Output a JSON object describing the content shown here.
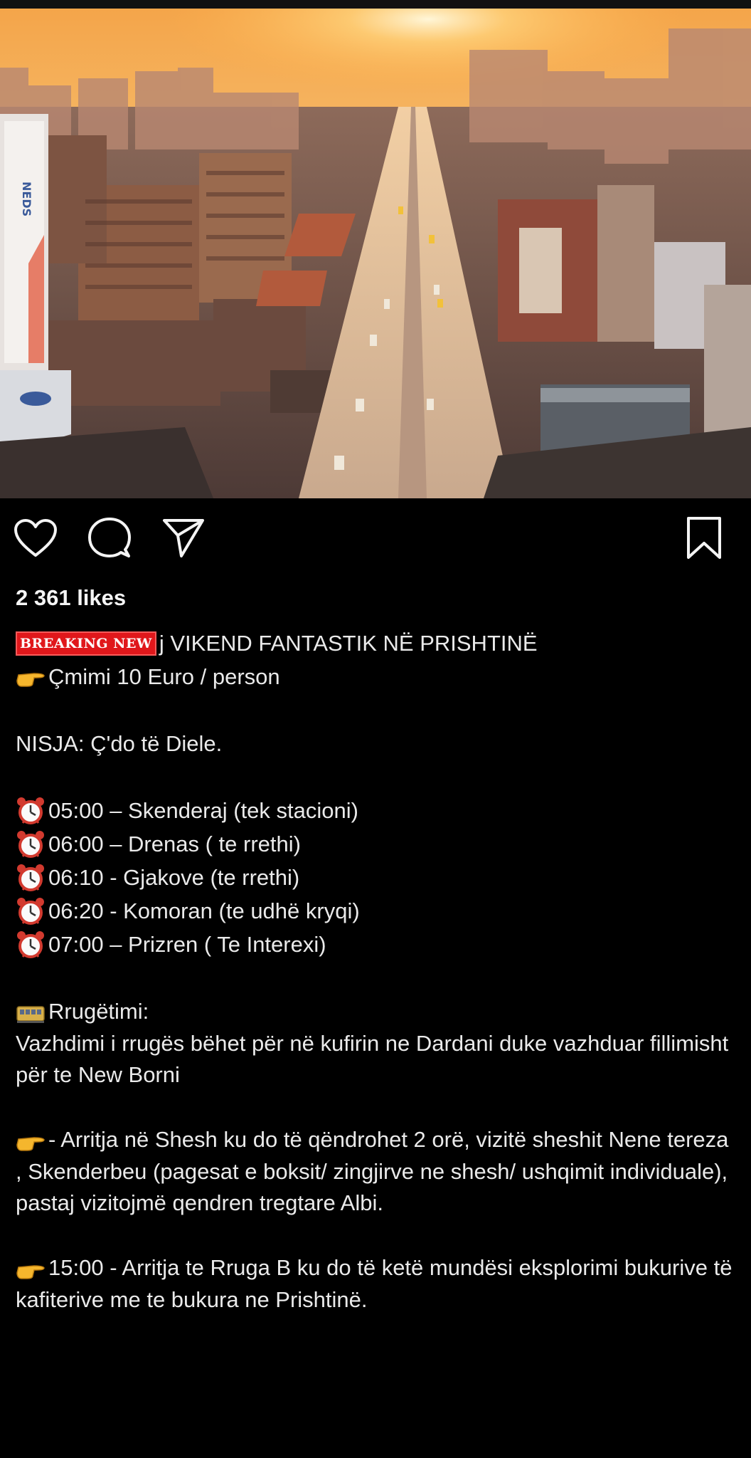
{
  "post": {
    "likes": "2 361 likes",
    "breaking_badge": "BREAKING NEW",
    "title_rest": "j VIKEND FANTASTIK NË PRISHTINË",
    "price": "Çmimi 10 Euro / person",
    "departure": "NISJA:  Ç'do të Diele.",
    "schedule": [
      {
        "text": "05:00 – Skenderaj (tek stacioni)"
      },
      {
        "text": "06:00 –  Drenas ( te rrethi)"
      },
      {
        "text": "06:10 -  Gjakove (te rrethi)"
      },
      {
        "text": "06:20 -  Komoran (te udhë kryqi)"
      },
      {
        "text": "07:00 – Prizren ( Te Interexi)"
      }
    ],
    "route_heading": "Rrugëtimi:",
    "route_text": "Vazhdimi i rrugës bëhet për në kufirin ne Dardani duke vazhduar fillimisht për te New Borni",
    "arrival_text": "- Arritja në Shesh ku do të qëndrohet 2 orë, vizitë sheshit Nene tereza , Skenderbeu (pagesat e boksit/ zingjirve ne shesh/ ushqimit individuale), pastaj vizitojmë qendren tregtare Albi.",
    "afternoon_text": "15:00 - Arritja te Rruga B ku do të ketë mundësi eksplorimi bukurive të kafiterive me te bukura ne Prishtinë."
  },
  "icons": {
    "like": "heart-icon",
    "comment": "comment-bubble-icon",
    "share": "paper-plane-icon",
    "save": "bookmark-icon",
    "pointing": "backhand-index-pointing-right-emoji",
    "alarm": "alarm-clock-emoji",
    "tram": "tram-car-emoji"
  },
  "photo": {
    "sign_text": "NEDS"
  }
}
